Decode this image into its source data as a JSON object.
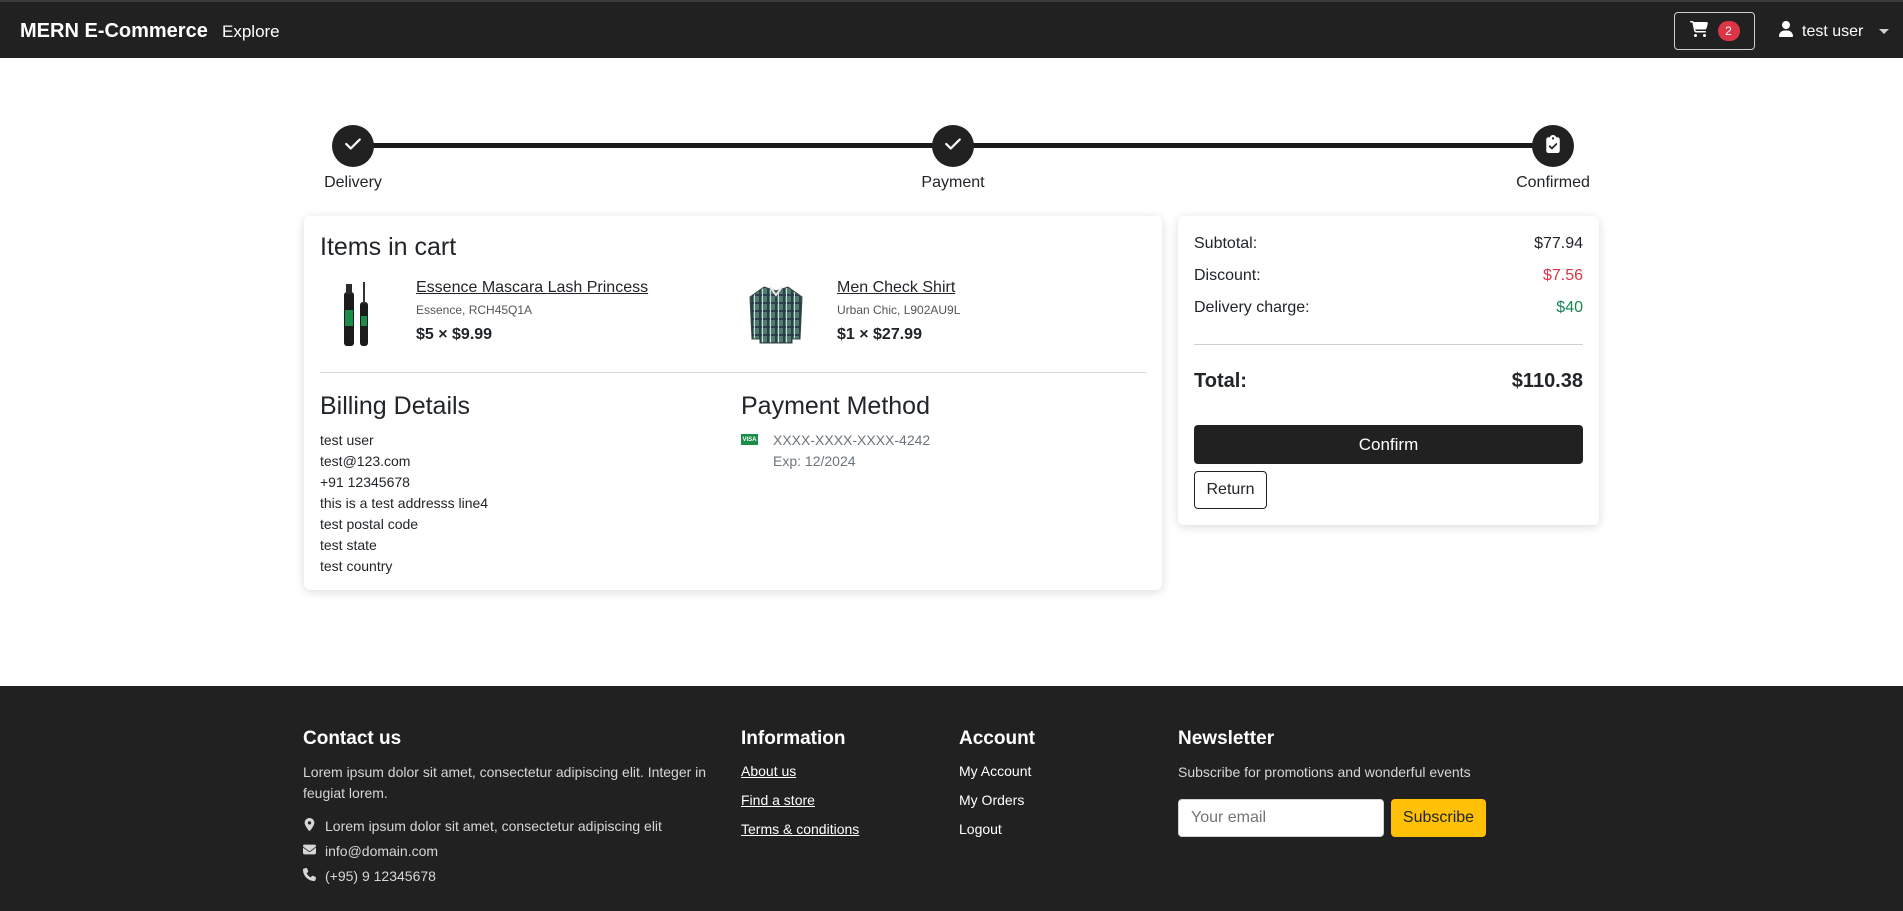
{
  "navbar": {
    "brand": "MERN E-Commerce",
    "explore": "Explore",
    "cart_count": "2",
    "user_name": "test user"
  },
  "stepper": {
    "steps": [
      {
        "label": "Delivery",
        "icon": "check-icon"
      },
      {
        "label": "Payment",
        "icon": "check-icon"
      },
      {
        "label": "Confirmed",
        "icon": "clipboard-check-icon"
      }
    ]
  },
  "cart": {
    "title": "Items in cart",
    "items": [
      {
        "name": "Essence Mascara Lash Princess",
        "meta": "Essence, RCH45Q1A",
        "price": "$5 × $9.99",
        "image": "mascara-image"
      },
      {
        "name": "Men Check Shirt",
        "meta": "Urban Chic, L902AU9L",
        "price": "$1 × $27.99",
        "image": "shirt-image"
      }
    ]
  },
  "billing": {
    "title": "Billing Details",
    "lines": [
      "test user",
      "test@123.com",
      "+91 12345678",
      "this is a test addresss line4",
      "test postal code",
      "test state",
      "test country"
    ]
  },
  "payment": {
    "title": "Payment Method",
    "card_brand": "VISA",
    "card_number": "XXXX-XXXX-XXXX-4242",
    "expiry": "Exp: 12/2024"
  },
  "summary": {
    "subtotal_label": "Subtotal:",
    "subtotal": "$77.94",
    "discount_label": "Discount:",
    "discount": "$7.56",
    "delivery_label": "Delivery charge:",
    "delivery": "$40",
    "total_label": "Total:",
    "total": "$110.38",
    "confirm_label": "Confirm",
    "return_label": "Return",
    "colors": {
      "discount": "#dc3545",
      "delivery": "#198754"
    }
  },
  "footer": {
    "contact": {
      "title": "Contact us",
      "text": "Lorem ipsum dolor sit amet, consectetur adipiscing elit. Integer in feugiat lorem.",
      "address": "Lorem ipsum dolor sit amet, consectetur adipiscing elit",
      "email": "info@domain.com",
      "phone": "(+95) 9 12345678"
    },
    "information": {
      "title": "Information",
      "links": [
        "About us",
        "Find a store",
        "Terms & conditions"
      ]
    },
    "account": {
      "title": "Account",
      "links": [
        "My Account",
        "My Orders",
        "Logout"
      ]
    },
    "newsletter": {
      "title": "Newsletter",
      "text": "Subscribe for promotions and wonderful events",
      "placeholder": "Your email",
      "button": "Subscribe"
    }
  }
}
